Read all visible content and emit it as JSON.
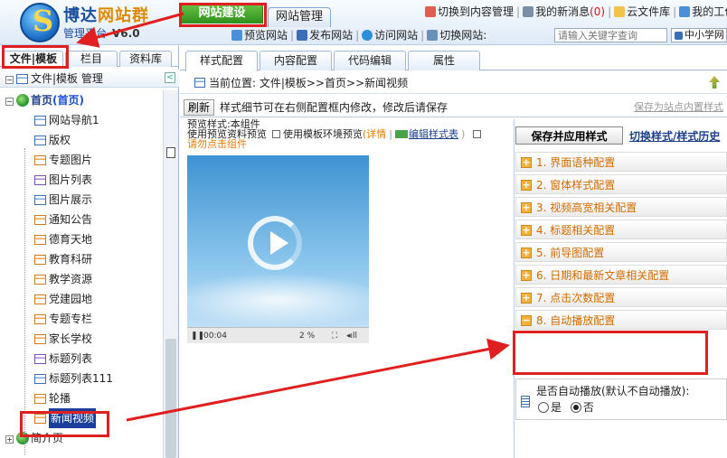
{
  "header": {
    "brand_main": "博达",
    "brand_accent": "网站群",
    "brand_sub": "管理平台",
    "version": "V6.0",
    "tab_active": "网站建设",
    "tab_other": "网站管理",
    "links": [
      "切换到内容管理",
      "我的新消息",
      "(0)",
      "云文件库",
      "我的工作台"
    ],
    "tools": [
      "预览网站",
      "发布网站",
      "访问网站",
      "切换网站:"
    ],
    "search_placeholder": "请输入关键字查询",
    "site_select": "中小学网"
  },
  "left": {
    "tabs": [
      "文件|模板",
      "栏目",
      "资料库"
    ],
    "title": "文件|模板 管理",
    "root": "首页",
    "root_suffix": "(首页)",
    "items": [
      {
        "label": "网站导航1",
        "icon": "blue"
      },
      {
        "label": "版权",
        "icon": "blue"
      },
      {
        "label": "专题图片",
        "icon": "orange"
      },
      {
        "label": "图片列表",
        "icon": "purple"
      },
      {
        "label": "图片展示",
        "icon": "blue"
      },
      {
        "label": "通知公告",
        "icon": "orange"
      },
      {
        "label": "德育天地",
        "icon": "orange"
      },
      {
        "label": "教育科研",
        "icon": "orange"
      },
      {
        "label": "教学资源",
        "icon": "orange"
      },
      {
        "label": "党建园地",
        "icon": "orange"
      },
      {
        "label": "专题专栏",
        "icon": "orange"
      },
      {
        "label": "家长学校",
        "icon": "orange"
      },
      {
        "label": "标题列表",
        "icon": "purple"
      },
      {
        "label": "标题列表111",
        "icon": "blue"
      },
      {
        "label": "轮播",
        "icon": "orange"
      },
      {
        "label": "新闻视频",
        "icon": "orange"
      }
    ],
    "next_root": "简介页"
  },
  "main": {
    "tabs": [
      "样式配置",
      "内容配置",
      "代码编辑",
      "属性"
    ],
    "location": "当前位置: 文件|模板>>首页>>新闻视频",
    "refresh_label": "刷新",
    "hint": "样式细节可在右侧配置框内修改，修改后请保存",
    "save_standard": "保存为站点内置样式",
    "preview": {
      "line1": "预览样式:本组件",
      "line2_a": "使用预览资料预览",
      "line2_b": "使用模板环境预览",
      "details": "(详情",
      "edit_style": "编辑样式表",
      "line3": "请勿点击组件",
      "time": "00:04",
      "volume": "2 %"
    },
    "config": {
      "save_apply": "保存并应用样式",
      "switch_link": "切换样式/样式历史",
      "sections": [
        "1. 界面语种配置",
        "2. 窗体样式配置",
        "3. 视频高宽相关配置",
        "4. 标题相关配置",
        "5. 前导图配置",
        "6. 日期和最新文章相关配置",
        "7. 点击次数配置",
        "8. 自动播放配置"
      ],
      "question": "是否自动播放(默认不自动播放):",
      "opt_yes": "是",
      "opt_no": "否"
    }
  },
  "colors": {
    "annotation": "#e02020",
    "accent_orange": "#d06b00",
    "link_blue": "#1e3f8a"
  }
}
